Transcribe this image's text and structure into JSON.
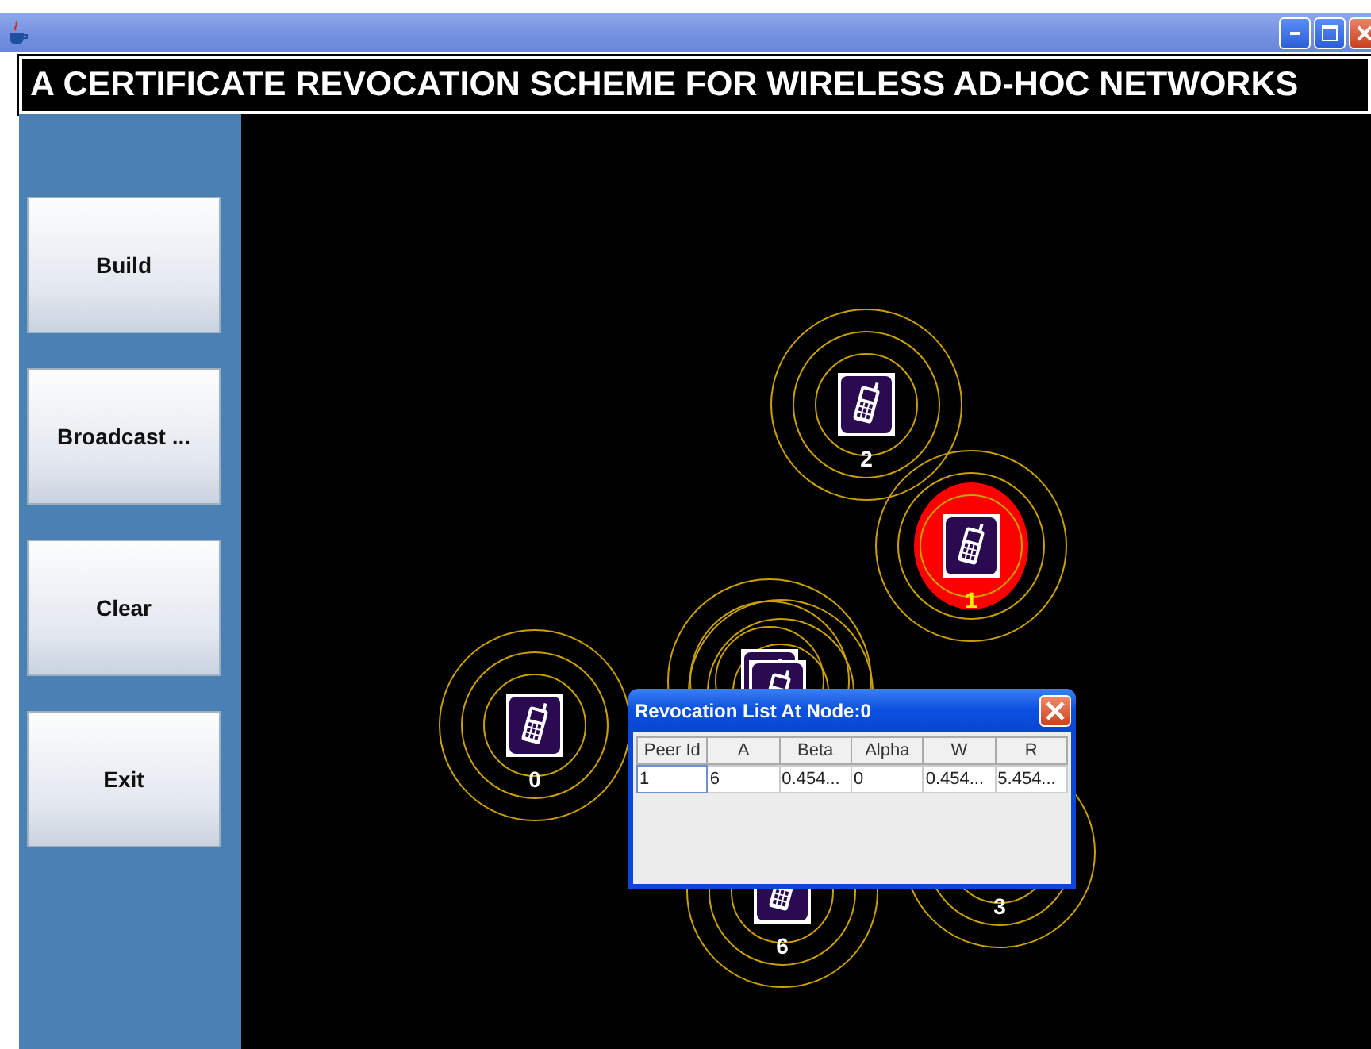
{
  "header": {
    "title": "A CERTIFICATE REVOCATION SCHEME FOR WIRELESS AD-HOC NETWORKS"
  },
  "sidebar": {
    "buttons": [
      "Build",
      "Broadcast ...",
      "Clear",
      "Exit"
    ]
  },
  "network": {
    "nodes": [
      {
        "label": "0",
        "revoked": false
      },
      {
        "label": "2",
        "revoked": false
      },
      {
        "label": "1",
        "revoked": true
      },
      {
        "label": "6",
        "revoked": false
      },
      {
        "label": "3",
        "revoked": false
      }
    ]
  },
  "dialog": {
    "title": "Revocation List At Node:0",
    "columns": [
      "Peer Id",
      "A",
      "Beta",
      "Alpha",
      "W",
      "R"
    ],
    "rows": [
      {
        "cells": [
          {
            "text": "1",
            "focused": true
          },
          {
            "text": "6",
            "focused": false
          },
          {
            "text": "0.454...",
            "focused": false
          },
          {
            "text": "0",
            "focused": false
          },
          {
            "text": "0.454...",
            "focused": false
          },
          {
            "text": "5.454...",
            "focused": false
          }
        ]
      }
    ]
  }
}
